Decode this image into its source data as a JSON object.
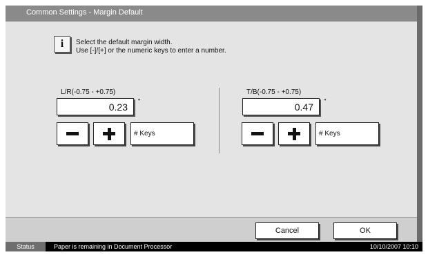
{
  "title": "Common Settings - Margin Default",
  "info": {
    "icon": "info-icon",
    "line1": "Select the default margin width.",
    "line2": "Use [-]/[+] or the numeric keys to enter a number."
  },
  "lr": {
    "range_label": "L/R(-0.75 - +0.75)",
    "value": "0.23",
    "unit": "\"",
    "keys_label": "# Keys"
  },
  "tb": {
    "range_label": "T/B(-0.75 - +0.75)",
    "value": "0.47",
    "unit": "\"",
    "keys_label": "# Keys"
  },
  "buttons": {
    "cancel": "Cancel",
    "ok": "OK"
  },
  "status": {
    "button": "Status",
    "message": "Paper is remaining in Document Processor",
    "datetime": "10/10/2007   10:10"
  }
}
